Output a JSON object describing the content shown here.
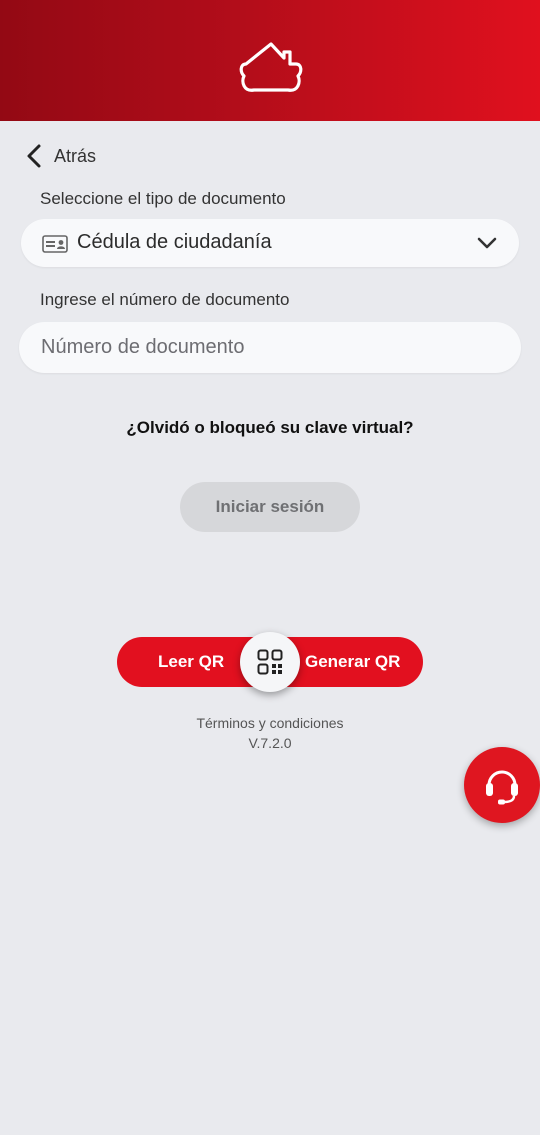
{
  "header": {
    "logo_icon": "house-icon",
    "bg_start": "#930914",
    "bg_end": "#e0101e"
  },
  "nav": {
    "back_label": "Atrás",
    "back_icon": "chevron-left-icon"
  },
  "form": {
    "doc_type_label": "Seleccione el tipo de documento",
    "doc_type_value": "Cédula de ciudadanía",
    "doc_type_icon": "id-card-icon",
    "doc_number_label": "Ingrese el número de documento",
    "doc_number_placeholder": "Número de documento",
    "doc_number_value": ""
  },
  "links": {
    "forgot": "¿Olvidó o bloqueó su clave virtual?"
  },
  "actions": {
    "login_label": "Iniciar sesión",
    "read_qr_label": "Leer QR",
    "generate_qr_label": "Generar QR",
    "qr_icon": "qr-code-icon",
    "accent": "#e2101f"
  },
  "footer": {
    "terms_label": "Términos y condiciones",
    "version": "V.7.2.0"
  },
  "fab": {
    "icon": "headset-icon"
  }
}
